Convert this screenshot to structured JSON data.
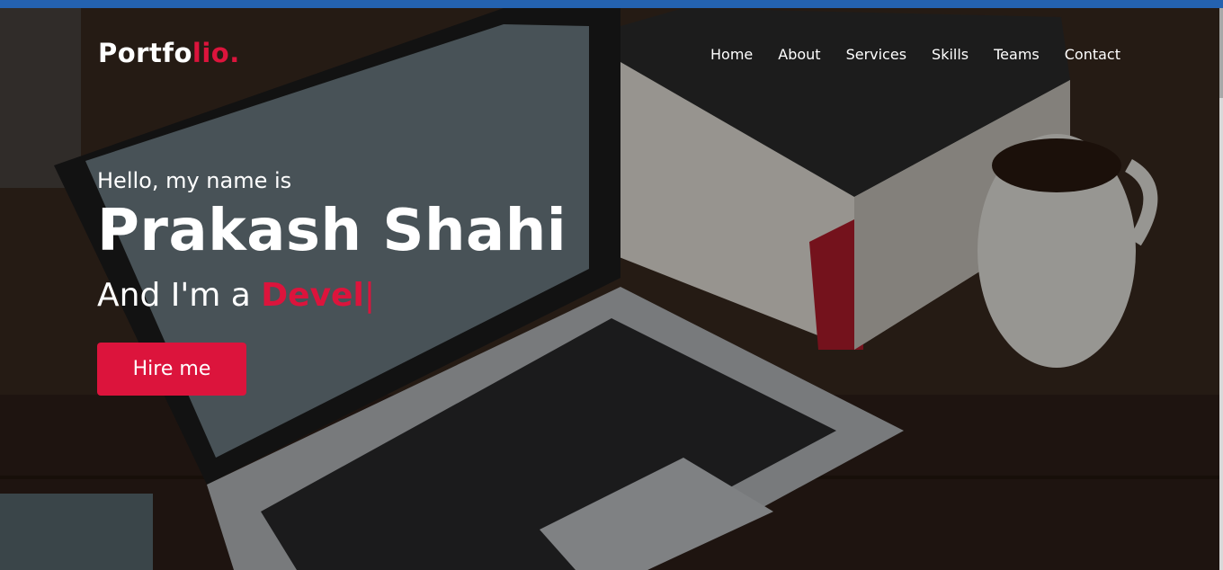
{
  "brand": {
    "name_main": "Portfo",
    "name_accent": "lio.",
    "accent_color": "#dc143c"
  },
  "nav": {
    "items": [
      {
        "label": "Home"
      },
      {
        "label": "About"
      },
      {
        "label": "Services"
      },
      {
        "label": "Skills"
      },
      {
        "label": "Teams"
      },
      {
        "label": "Contact"
      }
    ]
  },
  "hero": {
    "greeting": "Hello, my name is",
    "name": "Prakash Shahi",
    "role_prefix": "And I'm a ",
    "role_typed": "Devel",
    "cursor": "|",
    "cta_label": "Hire me",
    "background_description_icon": "laptop-books-coffee-photo"
  },
  "colors": {
    "topbar": "#2462b0",
    "button": "#dc143c",
    "text": "#ffffff"
  }
}
